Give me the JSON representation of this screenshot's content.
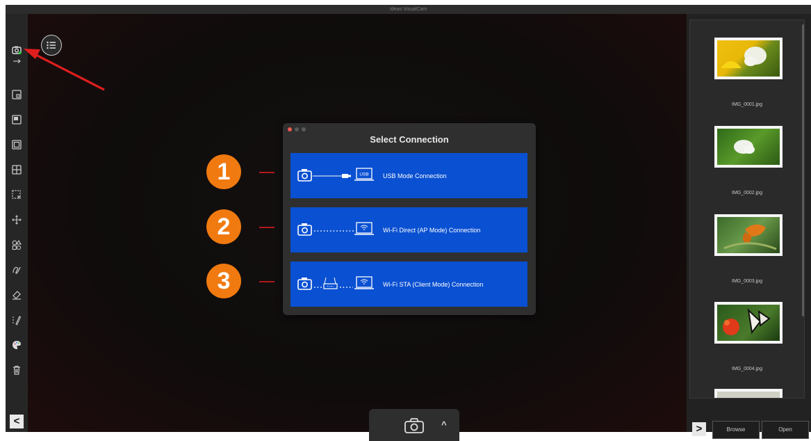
{
  "app": {
    "title": "Ideao VisualCam"
  },
  "toolbar": {
    "tools": [
      "camera-icon",
      "usb-arrow-icon",
      "pip-icon",
      "window-icon",
      "frame-icon",
      "grid-icon",
      "select-icon",
      "move-icon",
      "shapes-icon",
      "pen-icon",
      "eraser-icon",
      "dotted-pen-icon",
      "palette-icon",
      "trash-icon"
    ],
    "collapse_label": "<"
  },
  "dialog": {
    "title": "Select Connection",
    "options": [
      {
        "number": "1",
        "label": "USB Mode Connection",
        "usb_tag": "USB"
      },
      {
        "number": "2",
        "label": "Wi-Fi Direct (AP Mode) Connection"
      },
      {
        "number": "3",
        "label": "Wi-Fi STA (Client Mode) Connection"
      }
    ]
  },
  "capture": {
    "expand_label": "^"
  },
  "gallery": {
    "files": [
      {
        "name": "IMG_0001.jpg"
      },
      {
        "name": "IMG_0002.jpg"
      },
      {
        "name": "IMG_0003.jpg"
      },
      {
        "name": "IMG_0004.jpg"
      }
    ],
    "expand_label": ">",
    "browse_label": "Browse",
    "open_label": "Open"
  },
  "colors": {
    "accent_blue": "#0a50d2",
    "badge_orange": "#f07a10",
    "arrow_red": "#e01e1e"
  }
}
